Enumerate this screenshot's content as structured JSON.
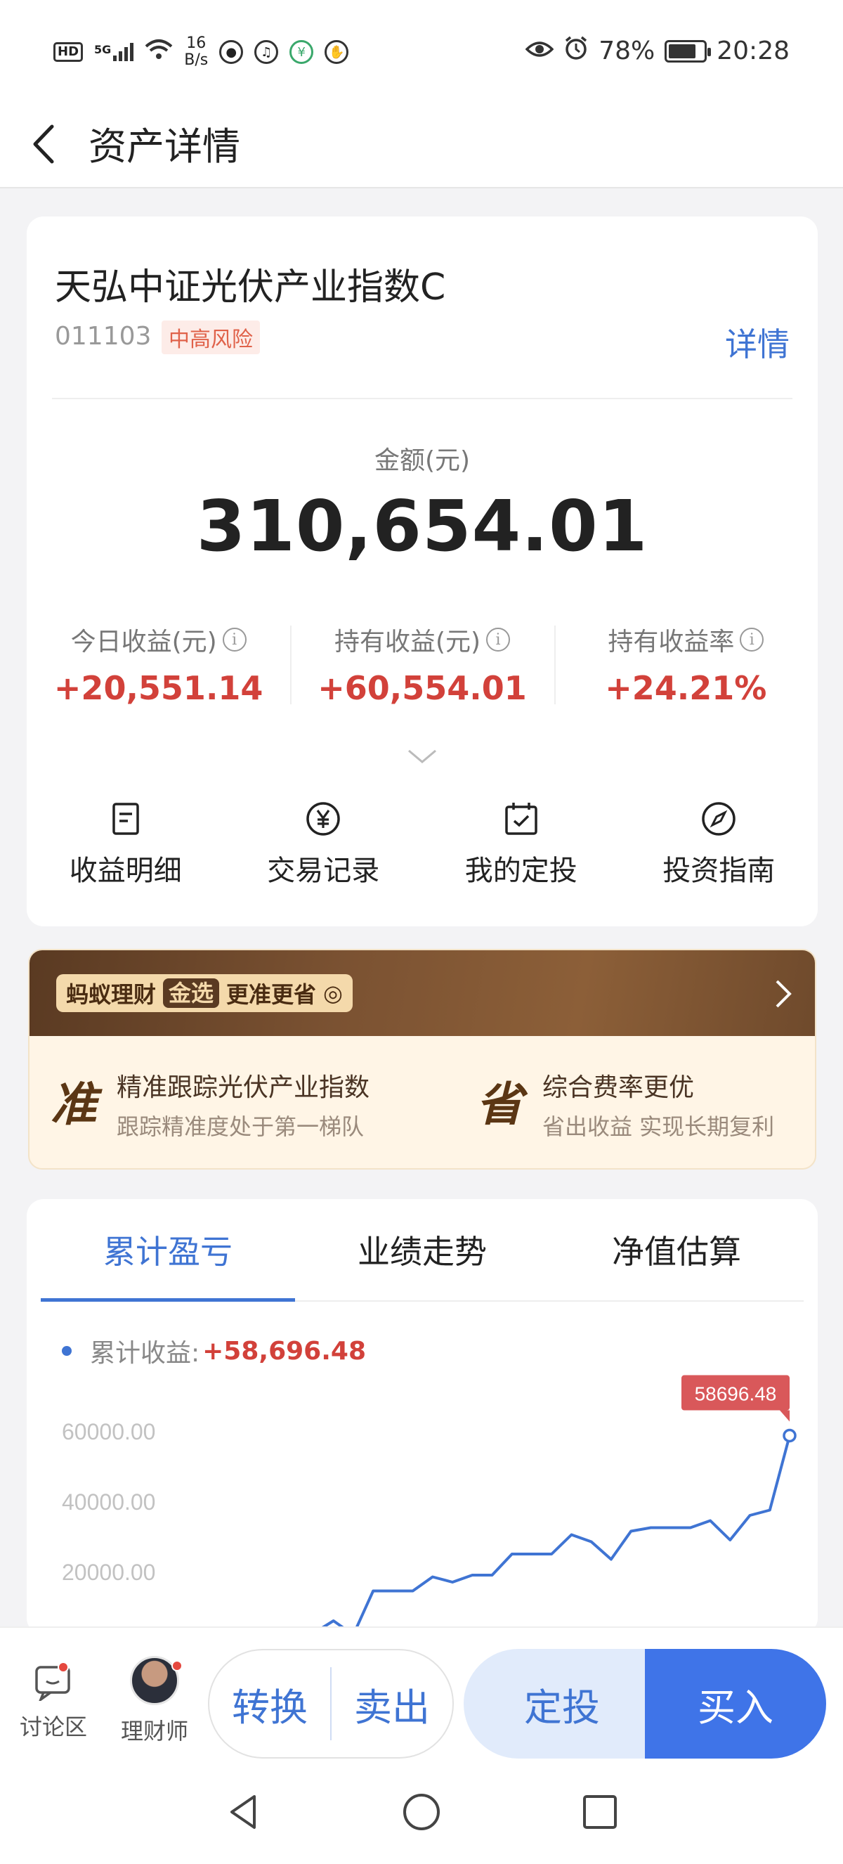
{
  "status_bar": {
    "hd": "HD",
    "signal": "5G",
    "speed_value": "16",
    "speed_unit": "B/s",
    "battery_percent": "78%",
    "battery_level": 0.78,
    "time": "20:28",
    "icons": [
      "wechat-icon",
      "audio-icon",
      "app-icon",
      "hand-icon",
      "eye-icon",
      "alarm-icon"
    ]
  },
  "header": {
    "title": "资产详情"
  },
  "fund": {
    "name": "天弘中证光伏产业指数C",
    "code": "011103",
    "risk": "中高风险",
    "detail_link": "详情",
    "amount_label": "金额(元)",
    "amount": "310,654.01",
    "stats": [
      {
        "label": "今日收益(元)",
        "value": "+20,551.14"
      },
      {
        "label": "持有收益(元)",
        "value": "+60,554.01"
      },
      {
        "label": "持有收益率",
        "value": "+24.21%"
      }
    ],
    "actions": [
      {
        "label": "收益明细",
        "icon": "document-icon"
      },
      {
        "label": "交易记录",
        "icon": "yen-icon"
      },
      {
        "label": "我的定投",
        "icon": "calendar-icon"
      },
      {
        "label": "投资指南",
        "icon": "compass-icon"
      }
    ]
  },
  "banner": {
    "brand": "蚂蚁理财",
    "gold_tag": "金选",
    "slogan": "更准更省",
    "features": [
      {
        "big": "准",
        "title": "精准跟踪光伏产业指数",
        "sub": "跟踪精准度处于第一梯队"
      },
      {
        "big": "省",
        "title": "综合费率更优",
        "sub": "省出收益 实现长期复利"
      }
    ]
  },
  "chart_tabs": [
    "累计盈亏",
    "业绩走势",
    "净值估算"
  ],
  "chart_legend": {
    "label": "累计收益:",
    "value": "+58,696.48"
  },
  "chart_data": {
    "type": "line",
    "series": [
      {
        "name": "累计收益",
        "values": [
          0,
          3000,
          2500,
          6000,
          2000,
          14500,
          14500,
          14500,
          18500,
          17000,
          19000,
          19000,
          25000,
          25000,
          25000,
          30500,
          28500,
          23500,
          31500,
          32500,
          32500,
          32500,
          34500,
          29000,
          36000,
          37500,
          58696.48
        ]
      }
    ],
    "yticks": [
      "60000.00",
      "40000.00",
      "20000.00"
    ],
    "ylim": [
      0,
      60000
    ],
    "last_value_label": "58696.48",
    "color": "#3f74d3"
  },
  "bottom_bar": {
    "discuss_label": "讨论区",
    "advisor_label": "理财师",
    "convert_label": "转换",
    "sell_label": "卖出",
    "dingtou_label": "定投",
    "buy_label": "买入"
  }
}
